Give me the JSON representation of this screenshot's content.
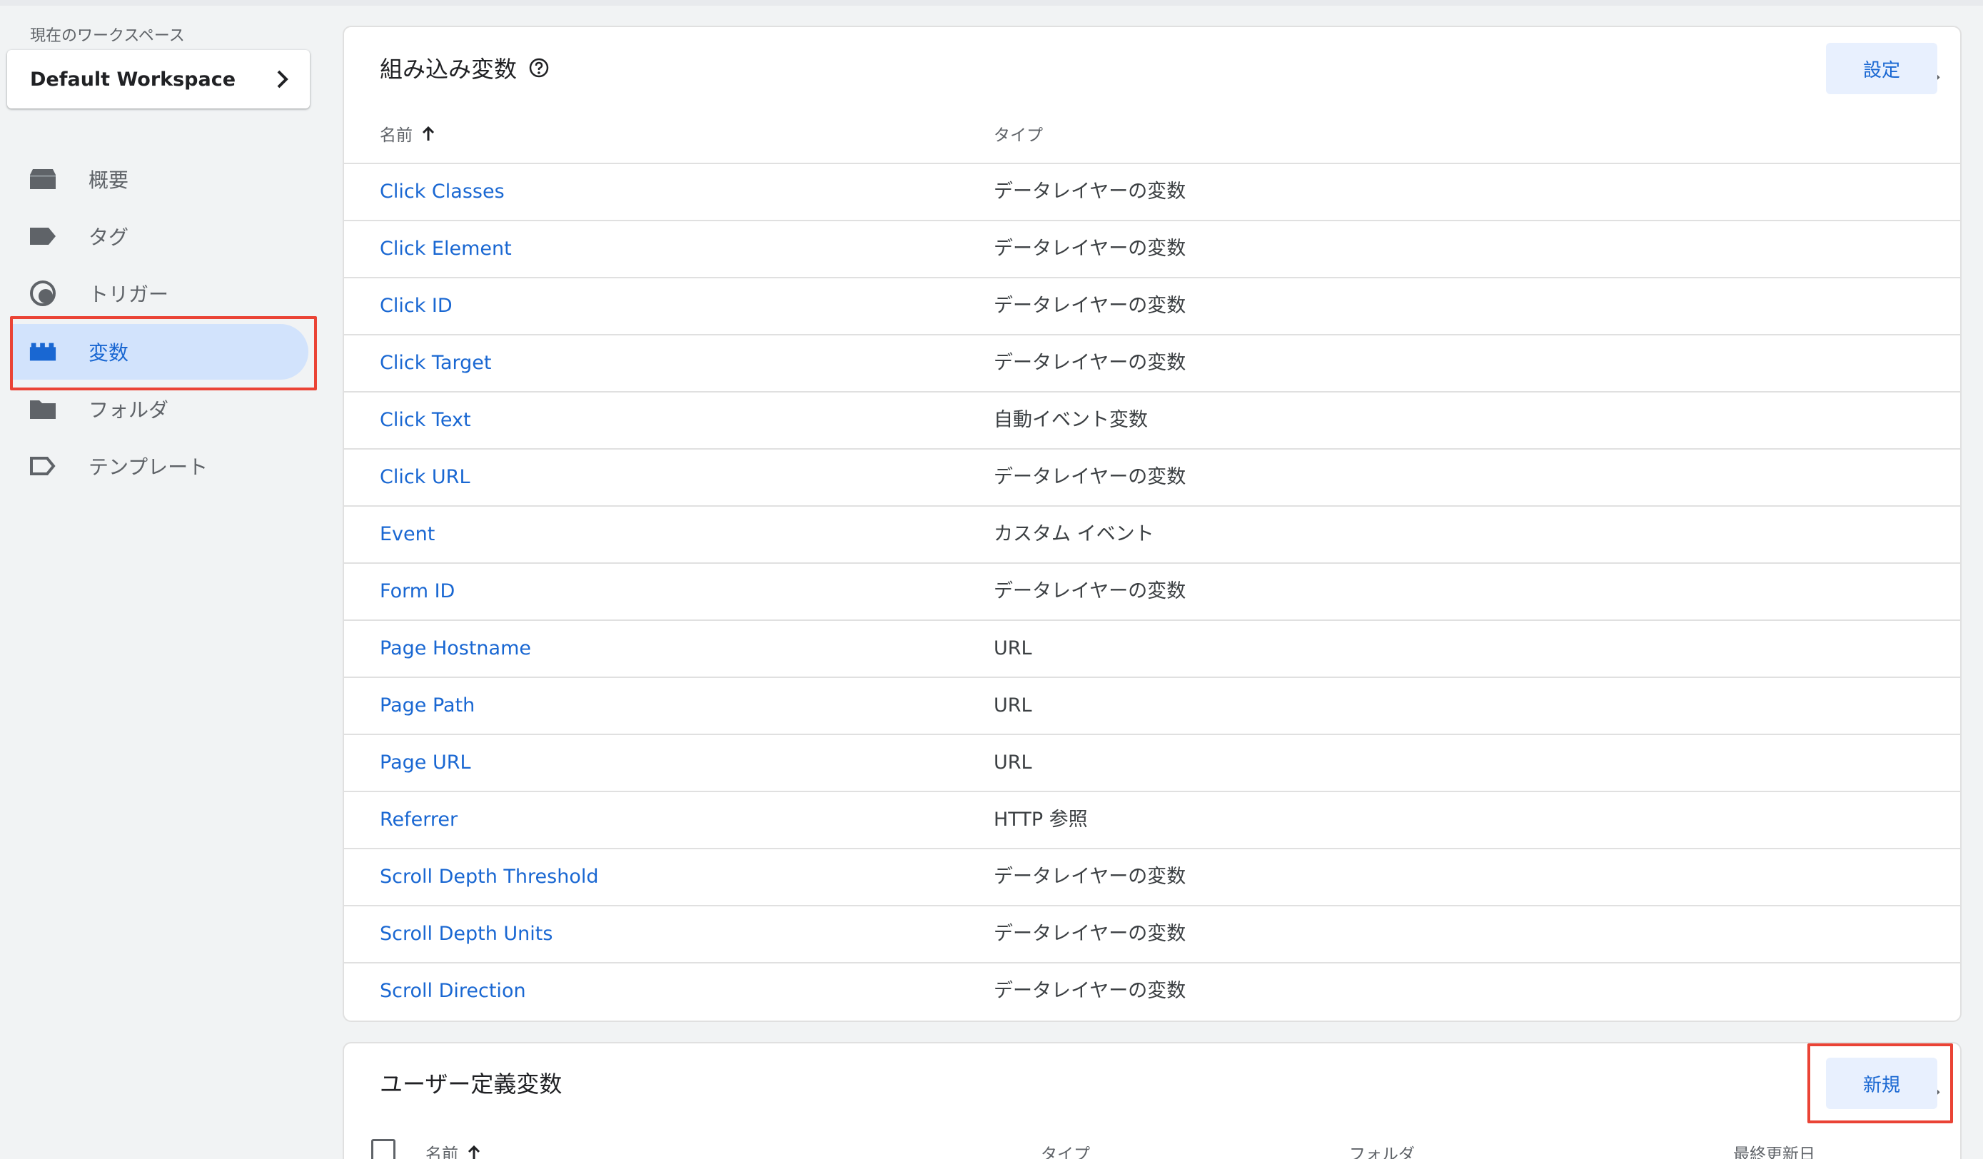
{
  "sidebar": {
    "workspace_label": "現在のワークスペース",
    "workspace_name": "Default Workspace",
    "items": [
      {
        "label": "概要",
        "icon": "overview-icon"
      },
      {
        "label": "タグ",
        "icon": "tag-icon"
      },
      {
        "label": "トリガー",
        "icon": "trigger-icon"
      },
      {
        "label": "変数",
        "icon": "variable-icon",
        "active": true
      },
      {
        "label": "フォルダ",
        "icon": "folder-icon"
      },
      {
        "label": "テンプレート",
        "icon": "template-icon"
      }
    ]
  },
  "builtin": {
    "title": "組み込み変数",
    "configure_label": "設定",
    "columns": {
      "name": "名前",
      "type": "タイプ"
    },
    "rows": [
      {
        "name": "Click Classes",
        "type": "データレイヤーの変数"
      },
      {
        "name": "Click Element",
        "type": "データレイヤーの変数"
      },
      {
        "name": "Click ID",
        "type": "データレイヤーの変数"
      },
      {
        "name": "Click Target",
        "type": "データレイヤーの変数"
      },
      {
        "name": "Click Text",
        "type": "自動イベント変数"
      },
      {
        "name": "Click URL",
        "type": "データレイヤーの変数"
      },
      {
        "name": "Event",
        "type": "カスタム イベント"
      },
      {
        "name": "Form ID",
        "type": "データレイヤーの変数"
      },
      {
        "name": "Page Hostname",
        "type": "URL"
      },
      {
        "name": "Page Path",
        "type": "URL"
      },
      {
        "name": "Page URL",
        "type": "URL"
      },
      {
        "name": "Referrer",
        "type": "HTTP 参照"
      },
      {
        "name": "Scroll Depth Threshold",
        "type": "データレイヤーの変数"
      },
      {
        "name": "Scroll Depth Units",
        "type": "データレイヤーの変数"
      },
      {
        "name": "Scroll Direction",
        "type": "データレイヤーの変数"
      }
    ]
  },
  "user_defined": {
    "title": "ユーザー定義変数",
    "new_label": "新規",
    "columns": {
      "name": "名前",
      "type": "タイプ",
      "folder": "フォルダ",
      "last_edited": "最終更新日"
    }
  },
  "colors": {
    "accent": "#1967d2",
    "active_bg": "#d2e3fc",
    "highlight": "#ea4335"
  }
}
